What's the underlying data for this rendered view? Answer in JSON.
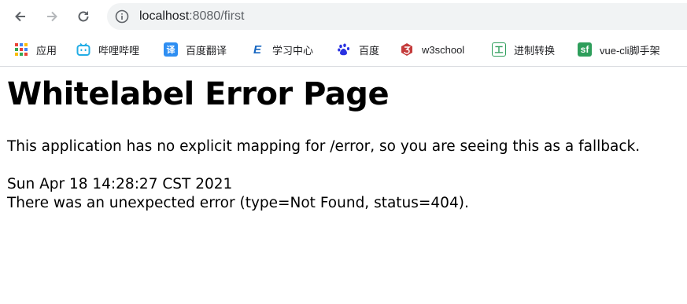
{
  "browser": {
    "url_host": "localhost",
    "url_path": ":8080/first"
  },
  "bookmarks": [
    {
      "label": "应用",
      "icon": "apps-grid-icon"
    },
    {
      "label": "哔哩哔哩",
      "icon": "bilibili-icon"
    },
    {
      "label": "百度翻译",
      "icon": "baidu-translate-icon",
      "glyph": "译",
      "color": "#2e8ef2"
    },
    {
      "label": "学习中心",
      "icon": "learning-center-icon",
      "glyph": "E",
      "color": "#1565c0"
    },
    {
      "label": "百度",
      "icon": "baidu-paw-icon"
    },
    {
      "label": "w3school",
      "icon": "w3school-icon"
    },
    {
      "label": "进制转换",
      "icon": "base-convert-icon",
      "glyph": "工",
      "color": "#2e9e5b"
    },
    {
      "label": "vue-cli脚手架",
      "icon": "segmentfault-icon",
      "glyph": "sf",
      "color": "#2e9e5b"
    }
  ],
  "page": {
    "title": "Whitelabel Error Page",
    "message": "This application has no explicit mapping for /error, so you are seeing this as a fallback.",
    "timestamp": "Sun Apr 18 14:28:27 CST 2021",
    "error": "There was an unexpected error (type=Not Found, status=404)."
  }
}
